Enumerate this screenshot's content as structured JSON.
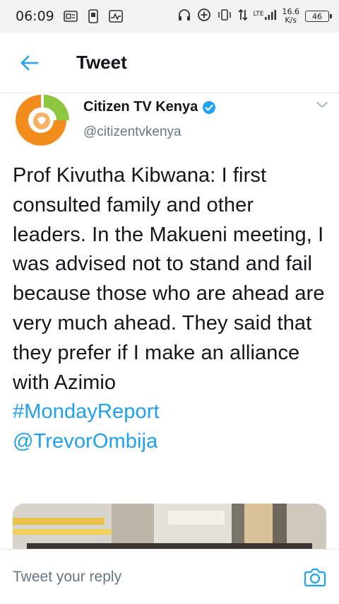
{
  "status_bar": {
    "time": "06:09",
    "network_type": "LTE",
    "speed_value": "16.6",
    "speed_unit": "K/s",
    "battery": "46"
  },
  "header": {
    "title": "Tweet",
    "back_icon": "arrow-left-icon"
  },
  "tweet": {
    "author_name": "Citizen TV Kenya",
    "author_handle": "@citizentvkenya",
    "verified": true,
    "text": "Prof Kivutha Kibwana: I first consulted family and other leaders. In the Makueni meeting, I was advised not to stand and fail because those who are ahead are very much ahead. They said that they prefer if I make an alliance with Azimio",
    "hashtag": "#MondayReport",
    "mention": "@TrevorOmbija"
  },
  "reply_bar": {
    "placeholder": "Tweet your reply",
    "camera_icon": "camera-icon"
  },
  "colors": {
    "accent": "#1da1f2",
    "avatar_orange": "#f28c1c",
    "avatar_green": "#8dc63f"
  }
}
